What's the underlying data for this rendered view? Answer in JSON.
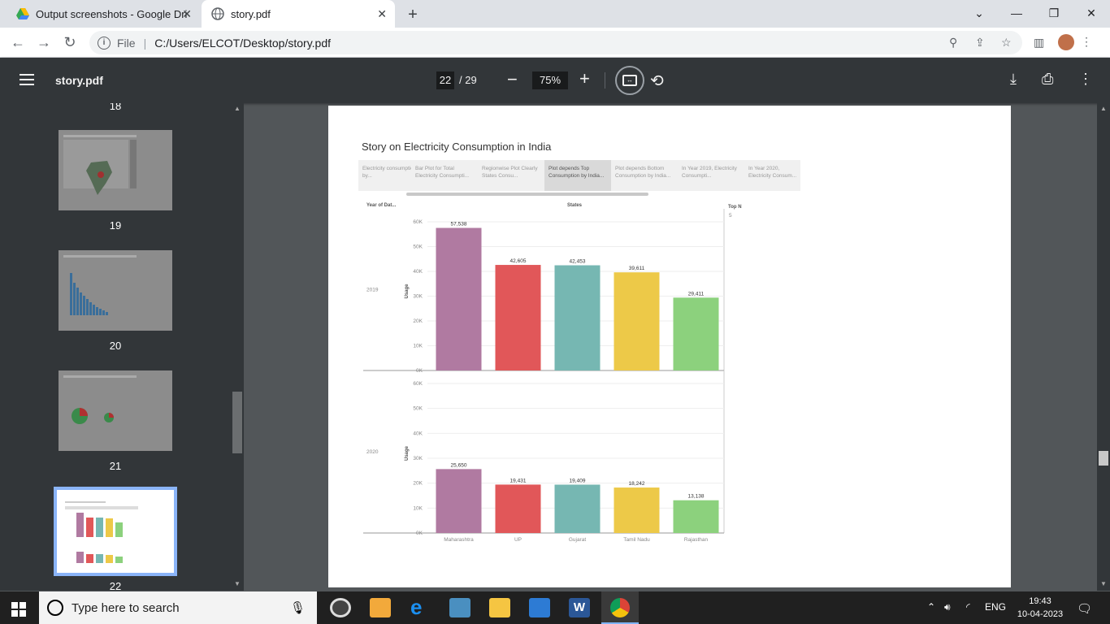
{
  "browser": {
    "tabs": [
      {
        "title": "Output screenshots - Google Dri"
      },
      {
        "title": "story.pdf"
      }
    ],
    "address": {
      "scheme_label": "File",
      "url": "C:/Users/ELCOT/Desktop/story.pdf"
    }
  },
  "pdf": {
    "title": "story.pdf",
    "current_page": "22",
    "total_pages": "/  29",
    "zoom": "75%"
  },
  "sidebar": {
    "thumbs": [
      {
        "label": "18"
      },
      {
        "label": "19"
      },
      {
        "label": "20"
      },
      {
        "label": "21"
      },
      {
        "label": "22"
      }
    ]
  },
  "story": {
    "title": "Story on Electricity Consumption in India",
    "tabs": [
      "Electricity consumption by...",
      "Bar Plot for Total Electricity Consumpti...",
      "Regionwise Plot Clearly States Consu...",
      "Plot depends Top Consumption by India...",
      "Plot depends Bottom Consumption by India...",
      "In Year 2019, Electricity Consumpti...",
      "In Year 2020, Electricity Consum..."
    ],
    "active_tab": 3,
    "row_header": "Year of Dat...",
    "col_header": "States",
    "filter_title": "Top N",
    "filter_value": "5"
  },
  "chart_data": {
    "type": "bar",
    "categories": [
      "Maharashtra",
      "UP",
      "Gujarat",
      "Tamil Nadu",
      "Rajasthan"
    ],
    "colors": [
      "#b07aa1",
      "#e15759",
      "#76b7b2",
      "#edc948",
      "#8cd17d"
    ],
    "ylabel": "Usage",
    "ylim": [
      0,
      60000
    ],
    "yticks": [
      "0K",
      "10K",
      "20K",
      "30K",
      "40K",
      "50K",
      "60K"
    ],
    "series": [
      {
        "name": "2019",
        "values": [
          57538,
          42605,
          42453,
          39611,
          29411
        ],
        "labels": [
          "57,538",
          "42,605",
          "42,453",
          "39,611",
          "29,411"
        ]
      },
      {
        "name": "2020",
        "values": [
          25650,
          19431,
          19409,
          18242,
          13138
        ],
        "labels": [
          "25,650",
          "19,431",
          "19,409",
          "18,242",
          "13,138"
        ]
      }
    ]
  },
  "taskbar": {
    "search_placeholder": "Type here to search",
    "language": "ENG",
    "time": "19:43",
    "date": "10-04-2023"
  }
}
